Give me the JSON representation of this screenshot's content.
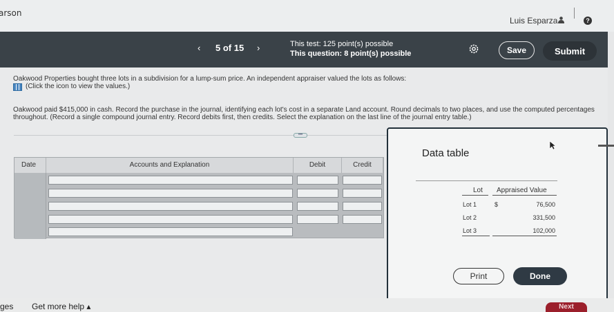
{
  "header": {
    "brand": "arson",
    "user_name": "Luis Esparza",
    "user_icon": "person-icon",
    "help_icon": "question-icon"
  },
  "nav": {
    "prev": "‹",
    "position": "5 of 15",
    "next": "›",
    "test_label": "This test: 125 point(s) possible",
    "question_label": "This question: 8 point(s) possible",
    "save_label": "Save",
    "submit_label": "Submit"
  },
  "question": {
    "intro": "Oakwood Properties bought three lots in a subdivision for a lump-sum price. An independent appraiser valued the lots as follows:",
    "icon_link": "(Click the icon to view the values.)",
    "instructions": "Oakwood paid $415,000 in cash. Record the purchase in the journal, identifying each lot's cost in a separate Land account. Round decimals to two places, and use the computed percentages throughout. (Record a single compound journal entry. Record debits first, then credits. Select the explanation on the last line of the journal entry table.)",
    "handle": "•••"
  },
  "journal": {
    "headers": [
      "Date",
      "Accounts and Explanation",
      "Debit",
      "Credit"
    ],
    "rows": 5
  },
  "data_table": {
    "title": "Data table",
    "col_lot": "Lot",
    "col_value": "Appraised Value",
    "currency": "$",
    "rows": [
      {
        "lot": "Lot 1",
        "value": "76,500"
      },
      {
        "lot": "Lot 2",
        "value": "331,500"
      },
      {
        "lot": "Lot 3",
        "value": "102,000"
      }
    ],
    "print_label": "Print",
    "done_label": "Done"
  },
  "footer": {
    "left_text": "ges",
    "help_link": "Get more help ▴",
    "next_label": "Next"
  },
  "colors": {
    "nav_bg": "#3a4248",
    "next_btn": "#9b1f2b",
    "done_btn": "#2f3a44"
  }
}
